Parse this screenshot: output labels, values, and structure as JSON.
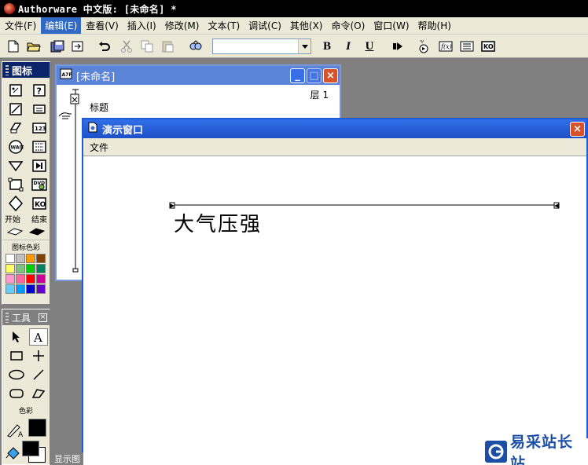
{
  "window": {
    "title": "Authorware 中文版: [未命名] *"
  },
  "menubar": {
    "items": [
      {
        "label": "文件(F)",
        "active": false
      },
      {
        "label": "编辑(E)",
        "active": true
      },
      {
        "label": "查看(V)",
        "active": false
      },
      {
        "label": "插入(I)",
        "active": false
      },
      {
        "label": "修改(M)",
        "active": false
      },
      {
        "label": "文本(T)",
        "active": false
      },
      {
        "label": "调试(C)",
        "active": false
      },
      {
        "label": "其他(X)",
        "active": false
      },
      {
        "label": "命令(O)",
        "active": false
      },
      {
        "label": "窗口(W)",
        "active": false
      },
      {
        "label": "帮助(H)",
        "active": false
      }
    ]
  },
  "toolbar": {
    "font_value": "",
    "bold_label": "B",
    "italic_label": "I",
    "underline_label": "U"
  },
  "palette": {
    "title": "图标",
    "start_label": "开始",
    "end_label": "结束",
    "color_label": "图标色彩",
    "swatches": [
      "#ffffff",
      "#c0c0c0",
      "#ff9900",
      "#804000",
      "#ffff66",
      "#80c080",
      "#00cc00",
      "#008060",
      "#ff99cc",
      "#ff6699",
      "#ff0000",
      "#cc0099",
      "#66ccff",
      "#0099ff",
      "#0000cc",
      "#6600cc"
    ]
  },
  "tools": {
    "title": "工具",
    "color_label": "色彩"
  },
  "flowline_window": {
    "title": "[未命名]",
    "layer_label": "层 1",
    "icon_label": "标题"
  },
  "presentation_window": {
    "title": "演示窗口",
    "menu_file": "文件",
    "stage_text": "大气压强"
  },
  "minimized_tab": {
    "label": "显示图"
  },
  "watermark": {
    "text": "易采站长站"
  }
}
